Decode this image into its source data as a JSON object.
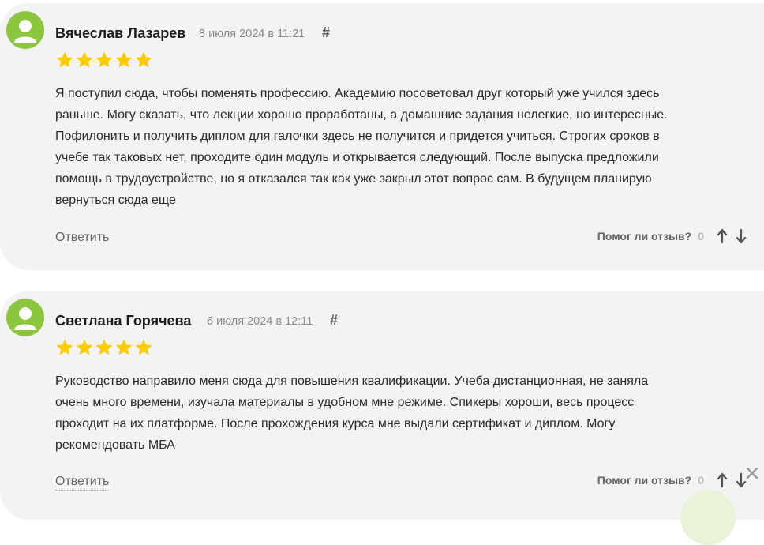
{
  "reviews": [
    {
      "author": "Вячеслав Лазарев",
      "date": "8 июля 2024 в 11:21",
      "hash": "#",
      "rating": 5,
      "text_lines": [
        "Я поступил сюда, чтобы поменять профессию. Академию посоветовал друг который уже учился здесь",
        "раньше. Могу сказать, что лекции хорошо проработаны, а домашние задания нелегкие, но интересные.",
        "Пофилонить и получить диплом для галочки здесь не получится и придется учиться. Строгих сроков в",
        "учебе так таковых нет, проходите один модуль и открывается следующий. После выпуска предложили",
        "помощь в трудоустройстве, но я отказался так как уже закрыл этот вопрос сам. В будущем планирую",
        "вернуться сюда еще"
      ],
      "reply_label": "Ответить",
      "helpful_label": "Помог ли отзыв?",
      "helpful_count": "0"
    },
    {
      "author": "Светлана Горячева",
      "date": "6 июля 2024 в 12:11",
      "hash": "#",
      "rating": 5,
      "text_lines": [
        "Руководство направило меня сюда для повышения квалификации. Учеба дистанционная, не заняла",
        "очень много времени, изучала материалы в удобном мне режиме. Спикеры хороши, весь процесс",
        "проходит на их платформе. После прохождения курса мне выдали сертификат и диплом. Могу",
        "рекомендовать МБА"
      ],
      "reply_label": "Ответить",
      "helpful_label": "Помог ли отзыв?",
      "helpful_count": "0"
    }
  ],
  "colors": {
    "card_bg": "#f3f3f3",
    "avatar": "#8cc63f",
    "star": "#ffcc00",
    "text": "#2a2a2a",
    "muted": "#8a8a8a"
  },
  "icons": {
    "avatar": "user-silhouette-icon",
    "star": "star-icon",
    "vote_up": "arrow-up-icon",
    "vote_down": "arrow-down-icon",
    "close": "close-icon"
  }
}
